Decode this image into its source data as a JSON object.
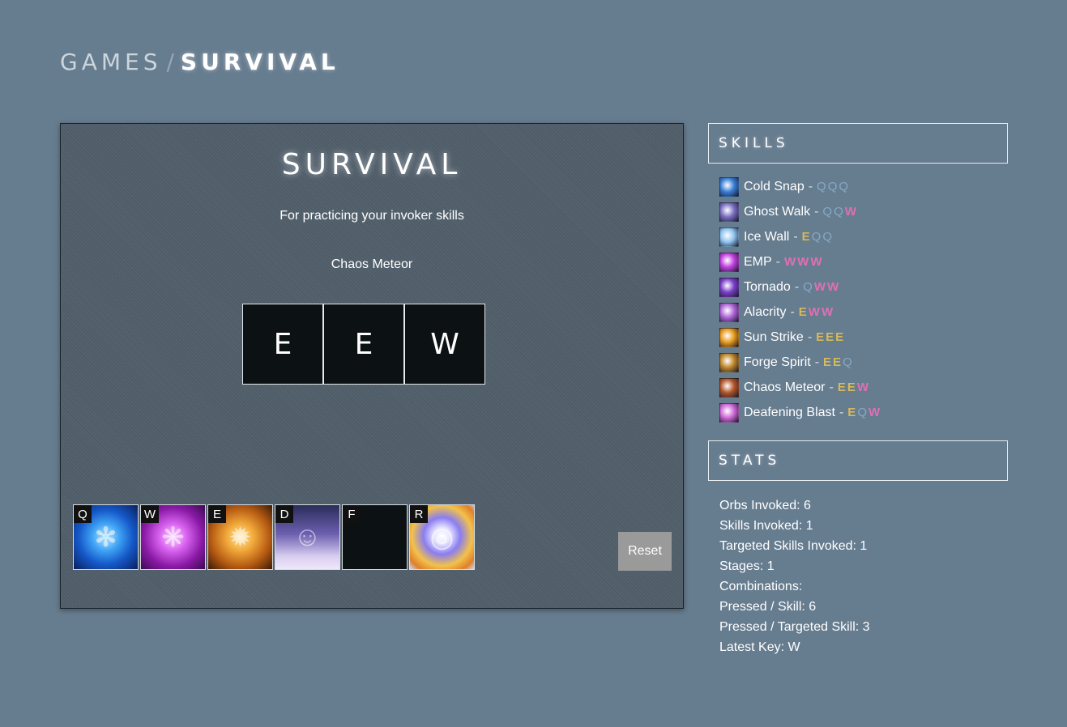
{
  "breadcrumb": {
    "parent": "GAMES",
    "separator": "/",
    "current": "SURVIVAL"
  },
  "game": {
    "title": "SURVIVAL",
    "subtitle": "For practicing your invoker skills",
    "target_skill": "Chaos Meteor",
    "orbs": [
      "E",
      "E",
      "W"
    ],
    "abilities": [
      {
        "key": "Q",
        "icon": "quas-icon"
      },
      {
        "key": "W",
        "icon": "wex-icon"
      },
      {
        "key": "E",
        "icon": "exort-icon"
      },
      {
        "key": "D",
        "icon": "invoked-skill-d-icon"
      },
      {
        "key": "F",
        "icon": "empty-slot-f"
      },
      {
        "key": "R",
        "icon": "invoke-icon"
      }
    ],
    "reset_label": "Reset"
  },
  "skills": {
    "heading": "SKILLS",
    "items": [
      {
        "name": "Cold Snap",
        "combo": [
          "Q",
          "Q",
          "Q"
        ],
        "icon": "cold-snap-icon",
        "icon_color": "#3a7fd6"
      },
      {
        "name": "Ghost Walk",
        "combo": [
          "Q",
          "Q",
          "W"
        ],
        "icon": "ghost-walk-icon",
        "icon_color": "#7b6fc2"
      },
      {
        "name": "Ice Wall",
        "combo": [
          "E",
          "Q",
          "Q"
        ],
        "icon": "ice-wall-icon",
        "icon_color": "#8fc4f0"
      },
      {
        "name": "EMP",
        "combo": [
          "W",
          "W",
          "W"
        ],
        "icon": "emp-icon",
        "icon_color": "#c240e0"
      },
      {
        "name": "Tornado",
        "combo": [
          "Q",
          "W",
          "W"
        ],
        "icon": "tornado-icon",
        "icon_color": "#7a3fc8"
      },
      {
        "name": "Alacrity",
        "combo": [
          "E",
          "W",
          "W"
        ],
        "icon": "alacrity-icon",
        "icon_color": "#b066d8"
      },
      {
        "name": "Sun Strike",
        "combo": [
          "E",
          "E",
          "E"
        ],
        "icon": "sun-strike-icon",
        "icon_color": "#e89a1c"
      },
      {
        "name": "Forge Spirit",
        "combo": [
          "E",
          "E",
          "Q"
        ],
        "icon": "forge-spirit-icon",
        "icon_color": "#c0872a"
      },
      {
        "name": "Chaos Meteor",
        "combo": [
          "E",
          "E",
          "W"
        ],
        "icon": "chaos-meteor-icon",
        "icon_color": "#b3562a"
      },
      {
        "name": "Deafening Blast",
        "combo": [
          "E",
          "Q",
          "W"
        ],
        "icon": "deafening-blast-icon",
        "icon_color": "#d06ad8"
      }
    ]
  },
  "stats": {
    "heading": "STATS",
    "items": [
      "Orbs Invoked: 6",
      "Skills Invoked: 1",
      "Targeted Skills Invoked: 1",
      "Stages: 1",
      "Combinations:",
      "Pressed / Skill: 6",
      "Pressed / Targeted Skill: 3",
      "Latest Key: W"
    ]
  }
}
